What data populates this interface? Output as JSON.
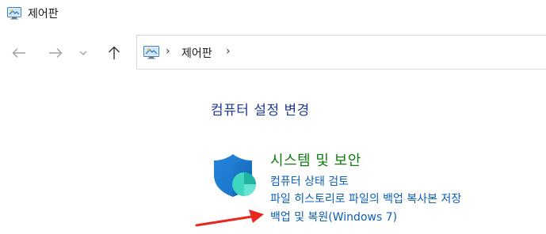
{
  "window": {
    "title": "제어판"
  },
  "navigation": {
    "back_icon": "arrow-left-icon",
    "forward_icon": "arrow-right-icon",
    "recent_icon": "chevron-down-icon",
    "up_icon": "arrow-up-icon"
  },
  "address_bar": {
    "location_icon": "control-panel-icon",
    "separator": "›",
    "crumbs": [
      "제어판"
    ]
  },
  "main": {
    "heading": "컴퓨터 설정 변경",
    "category": {
      "icon": "shield-icon",
      "title": "시스템 및 보안",
      "links": [
        "컴퓨터 상태 검토",
        "파일 히스토리로 파일의 백업 복사본 저장",
        "백업 및 복원(Windows 7)"
      ]
    }
  },
  "annotation": {
    "arrow_color": "#e8281e"
  },
  "colors": {
    "heading": "#1f3a93",
    "category_title": "#107c10",
    "link": "#0b5fb8"
  }
}
